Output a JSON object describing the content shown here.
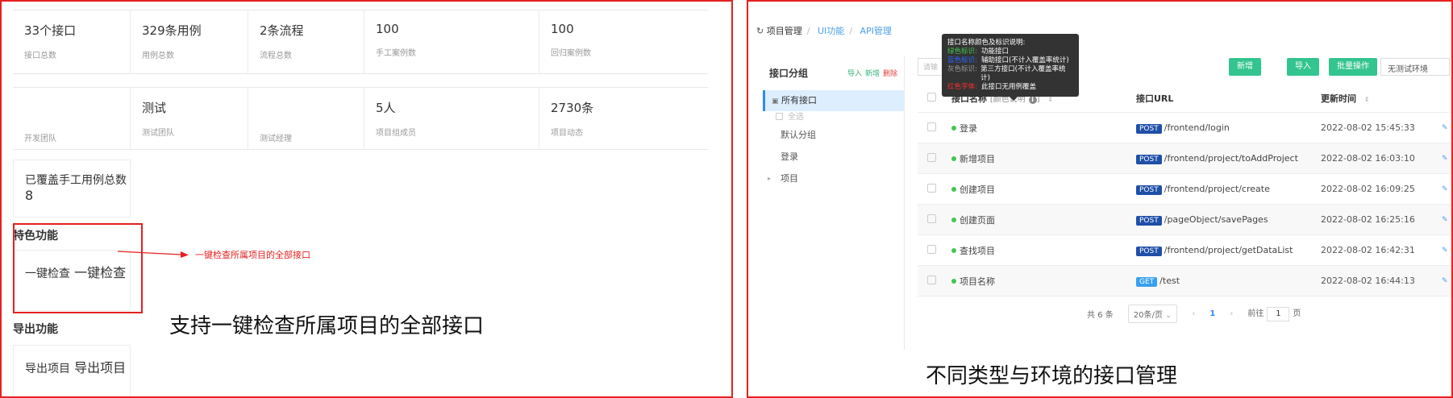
{
  "left": {
    "row1": [
      {
        "value": "33个接口",
        "label": "接口总数"
      },
      {
        "value": "329条用例",
        "label": "用例总数"
      },
      {
        "value": "2条流程",
        "label": "流程总数"
      },
      {
        "value": "100",
        "label": "手工案例数"
      },
      {
        "value": "100",
        "label": "回归案例数"
      }
    ],
    "row2": [
      {
        "value": "",
        "label": "开发团队"
      },
      {
        "value": "测试",
        "label": "测试团队"
      },
      {
        "value": "",
        "label": "测试经理"
      },
      {
        "value": "5人",
        "label": "项目组成员"
      },
      {
        "value": "2730条",
        "label": "项目动态"
      }
    ],
    "covered": {
      "value": "已覆盖手工用例总数",
      "label": "8"
    },
    "featured_title": "特色功能",
    "one_click": {
      "value": "一键检查",
      "label": "一键检查"
    },
    "annotation": "一键检查所属项目的全部接口",
    "export_title": "导出功能",
    "export_card": {
      "value": "导出项目",
      "label": "导出项目"
    },
    "caption": "支持一键检查所属项目的全部接口",
    "colors": {
      "accent": "#e52020"
    }
  },
  "right": {
    "breadcrumb": [
      "项目管理",
      "UI功能",
      "API管理"
    ],
    "tree": {
      "title": "接口分组",
      "actions": [
        "导入",
        "新增",
        "删除"
      ],
      "all": "所有接口",
      "select_all": "全选",
      "items": [
        "默认分组",
        "登录",
        "项目"
      ]
    },
    "search_placeholder": "请输",
    "buttons": [
      "新增",
      "导入",
      "批量操作"
    ],
    "env": "无测试环境",
    "tooltip": {
      "title": "接口名称颜色及标识说明:",
      "rows": [
        {
          "key": "绿色标识:",
          "text": "功能接口",
          "color": "#44c553"
        },
        {
          "key": "蓝色标识:",
          "text": "辅助接口(不计入覆盖率统计)",
          "color": "#2d66ff"
        },
        {
          "key": "灰色标识:",
          "text": "第三方接口(不计入覆盖率统计)",
          "color": "#999999"
        },
        {
          "key": "红色字体:",
          "text": "此接口无用例覆盖",
          "color": "#ff3030"
        }
      ]
    },
    "table": {
      "headers": {
        "name": "接口名称",
        "hint": "[颜色说明",
        "url": "接口URL",
        "time": "更新时间"
      },
      "rows": [
        {
          "name": "登录",
          "method": "POST",
          "url": "/frontend/login",
          "time": "2022-08-02 15:45:33"
        },
        {
          "name": "新增项目",
          "method": "POST",
          "url": "/frontend/project/toAddProject",
          "time": "2022-08-02 16:03:10"
        },
        {
          "name": "创建项目",
          "method": "POST",
          "url": "/frontend/project/create",
          "time": "2022-08-02 16:09:25"
        },
        {
          "name": "创建页面",
          "method": "POST",
          "url": "/pageObject/savePages",
          "time": "2022-08-02 16:25:16"
        },
        {
          "name": "查找项目",
          "method": "POST",
          "url": "/frontend/project/getDataList",
          "time": "2022-08-02 16:42:31"
        },
        {
          "name": "项目名称",
          "method": "GET",
          "url": "/test",
          "time": "2022-08-02 16:44:13"
        }
      ]
    },
    "pager": {
      "total": "共 6 条",
      "size": "20条/页",
      "current": "1",
      "goto": "前往",
      "goto_value": "1",
      "page_suffix": "页"
    },
    "caption": "不同类型与环境的接口管理",
    "colors": {
      "post": "#1f4fa8",
      "get": "#3aa0f0",
      "green": "#33c48f"
    }
  }
}
